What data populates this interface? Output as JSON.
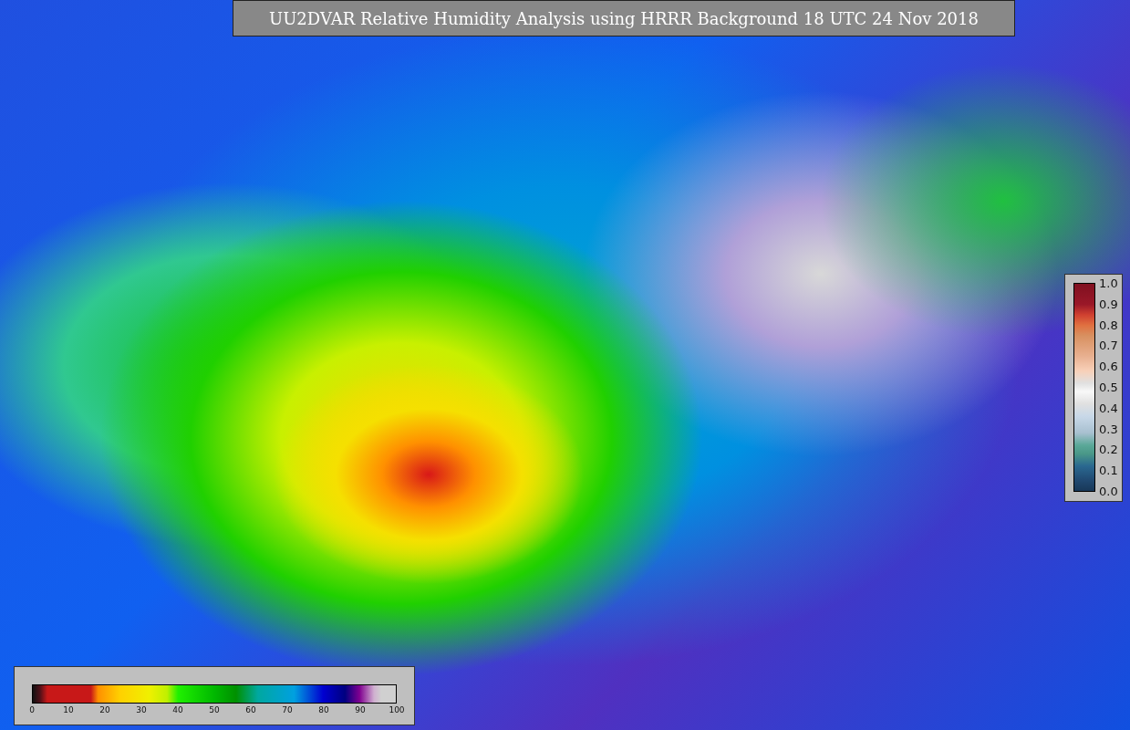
{
  "title": "UU2DVAR Relative Humidity Analysis using HRRR Background 18 UTC 24 Nov 2018",
  "difference_colorbar": {
    "ticks": [
      "1.0",
      "0.9",
      "0.8",
      "0.7",
      "0.6",
      "0.5",
      "0.4",
      "0.3",
      "0.2",
      "0.1",
      "0.0"
    ]
  },
  "humidity_colorbar": {
    "ticks": [
      "0",
      "10",
      "20",
      "30",
      "40",
      "50",
      "60",
      "70",
      "80",
      "90",
      "100"
    ]
  }
}
